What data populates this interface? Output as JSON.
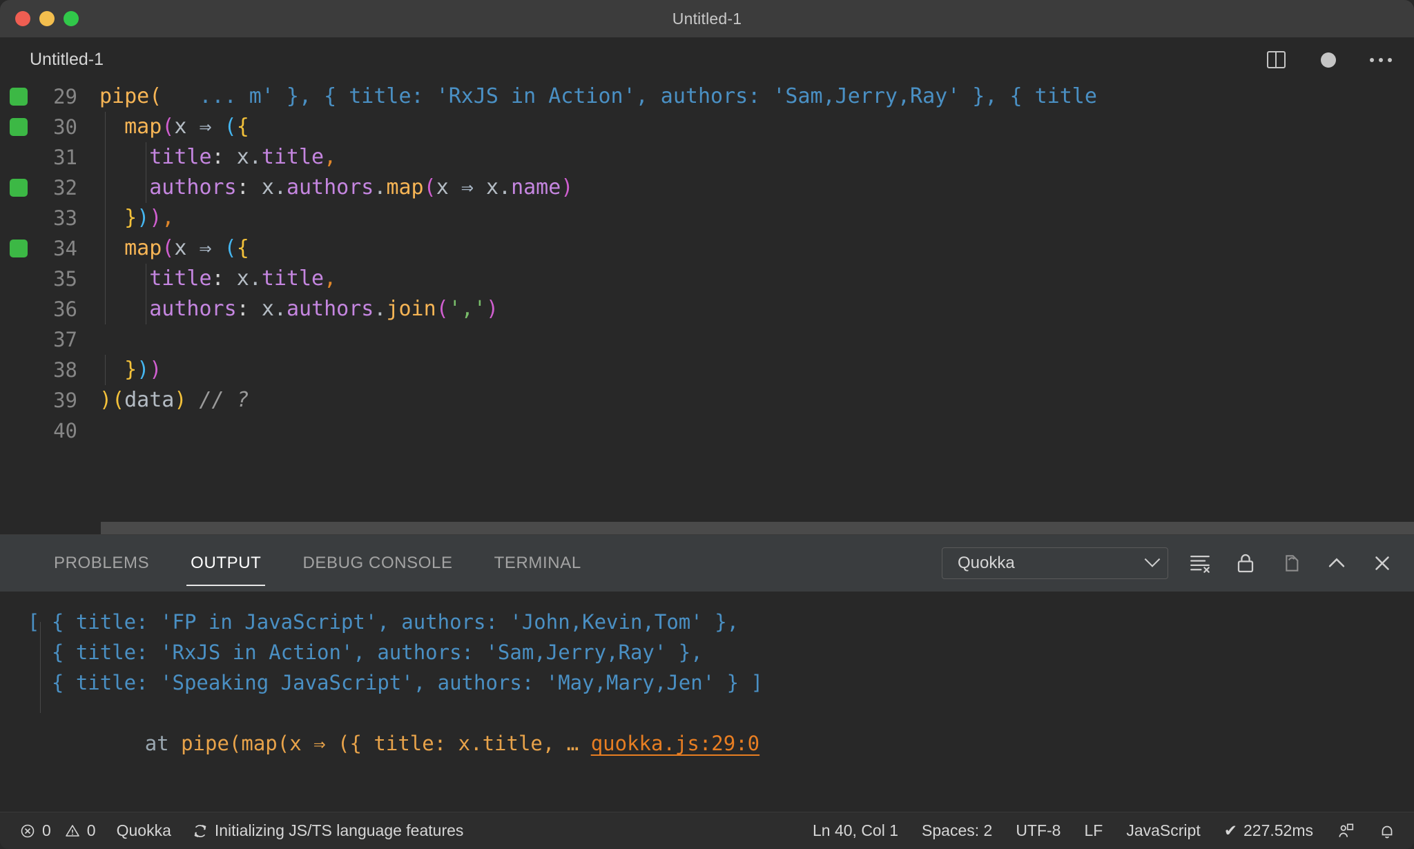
{
  "window": {
    "title": "Untitled-1",
    "traffic_lights": [
      "close-button",
      "minimize-button",
      "zoom-button"
    ]
  },
  "editor_tab": {
    "label": "Untitled-1",
    "actions": [
      "split-editor-icon",
      "unsaved-dot-icon",
      "more-actions-icon"
    ]
  },
  "editor": {
    "language": "JavaScript",
    "lines": [
      {
        "number": "29",
        "flag": true
      },
      {
        "number": "30",
        "flag": true
      },
      {
        "number": "31",
        "flag": false
      },
      {
        "number": "32",
        "flag": true
      },
      {
        "number": "33",
        "flag": false
      },
      {
        "number": "34",
        "flag": true
      },
      {
        "number": "35",
        "flag": false
      },
      {
        "number": "36",
        "flag": false
      },
      {
        "number": "37",
        "flag": false
      },
      {
        "number": "38",
        "flag": false
      },
      {
        "number": "39",
        "flag": false
      },
      {
        "number": "40",
        "flag": false
      }
    ],
    "code": {
      "l29_pipe": "pipe(",
      "l29_inline": "   ... m' }, { title: 'RxJS in Action', authors: 'Sam,Jerry,Ray' }, { title",
      "l30_map": "map",
      "l30_rest_x": "x",
      "l30_arrow": "⇒",
      "l31_title_key": "title",
      "l31_colon": ": ",
      "l31_x": "x",
      "l31_dot": ".",
      "l31_title_prop": "title",
      "l31_comma": ",",
      "l32_authors_key": "authors",
      "l32_x": "x",
      "l32_authors_prop": "authors",
      "l32_map": "map",
      "l32_name": "name",
      "l36_join": "join",
      "l36_str": "','",
      "l39_data": "data",
      "l39_comment": "// ?"
    }
  },
  "panel": {
    "tabs": [
      {
        "label": "PROBLEMS",
        "active": false
      },
      {
        "label": "OUTPUT",
        "active": true
      },
      {
        "label": "DEBUG CONSOLE",
        "active": false
      },
      {
        "label": "TERMINAL",
        "active": false
      }
    ],
    "channel_selected": "Quokka",
    "tools": [
      "clear-output-icon",
      "lock-scroll-icon",
      "open-in-editor-icon",
      "maximize-panel-icon",
      "close-panel-icon"
    ],
    "output_lines": [
      "[ { title: 'FP in JavaScript', authors: 'John,Kevin,Tom' },",
      "  { title: 'RxJS in Action', authors: 'Sam,Jerry,Ray' },",
      "  { title: 'Speaking JavaScript', authors: 'May,Mary,Jen' } ]"
    ],
    "stack_prefix": "at ",
    "stack_body": "pipe(map(x ⇒ ({ title: x.title, … ",
    "stack_link": "quokka.js:29:0"
  },
  "statusbar": {
    "errors": "0",
    "warnings": "0",
    "quokka": "Quokka",
    "task": "Initializing JS/TS language features",
    "cursor": "Ln 40, Col 1",
    "indent": "Spaces: 2",
    "encoding": "UTF-8",
    "eol": "LF",
    "language": "JavaScript",
    "timing": "227.52ms",
    "timing_check": "✔",
    "icons": [
      "error-icon",
      "warning-icon",
      "sync-icon",
      "remote-account-icon",
      "bell-icon"
    ]
  },
  "colors": {
    "accent_green": "#3cb845",
    "link_orange": "#e87e22",
    "output_blue": "#4a90c4",
    "panel_bg": "#3a3d3f",
    "editor_bg": "#282828"
  }
}
